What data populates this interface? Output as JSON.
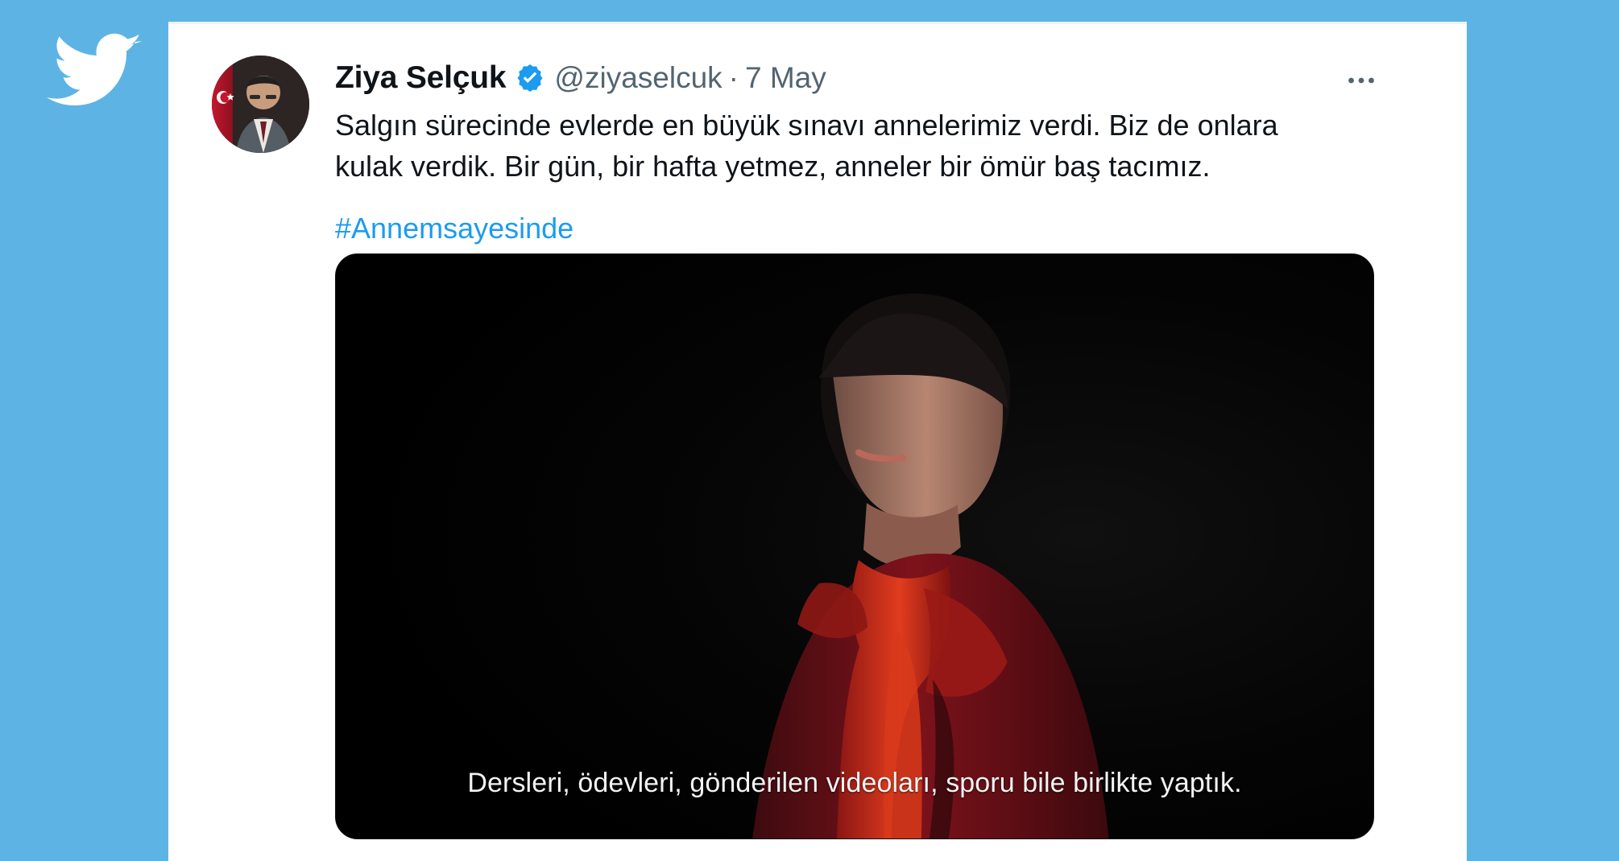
{
  "brand": {
    "icon": "twitter-bird-icon",
    "color": "#ffffff"
  },
  "tweet": {
    "author": {
      "display_name": "Ziya Selçuk",
      "handle": "@ziyaselcuk",
      "avatar_icon": "avatar"
    },
    "meta": {
      "separator": "·",
      "date": "7 May"
    },
    "text": "Salgın sürecinde evlerde en büyük sınavı annelerimiz verdi. Biz de onlara\nkulak verdik. Bir gün, bir hafta yetmez, anneler bir ömür baş tacımız.",
    "hashtag": "#Annemsayesinde",
    "more_icon": "more-horizontal-icon",
    "verified_icon": "verified-badge-icon",
    "media": {
      "subtitle": "Dersleri, ödevleri, gönderilen videoları, sporu bile birlikte yaptık."
    }
  },
  "colors": {
    "background": "#5db4e4",
    "card": "#ffffff",
    "text_primary": "#0f1419",
    "text_secondary": "#536471",
    "link": "#1d9bf0"
  }
}
